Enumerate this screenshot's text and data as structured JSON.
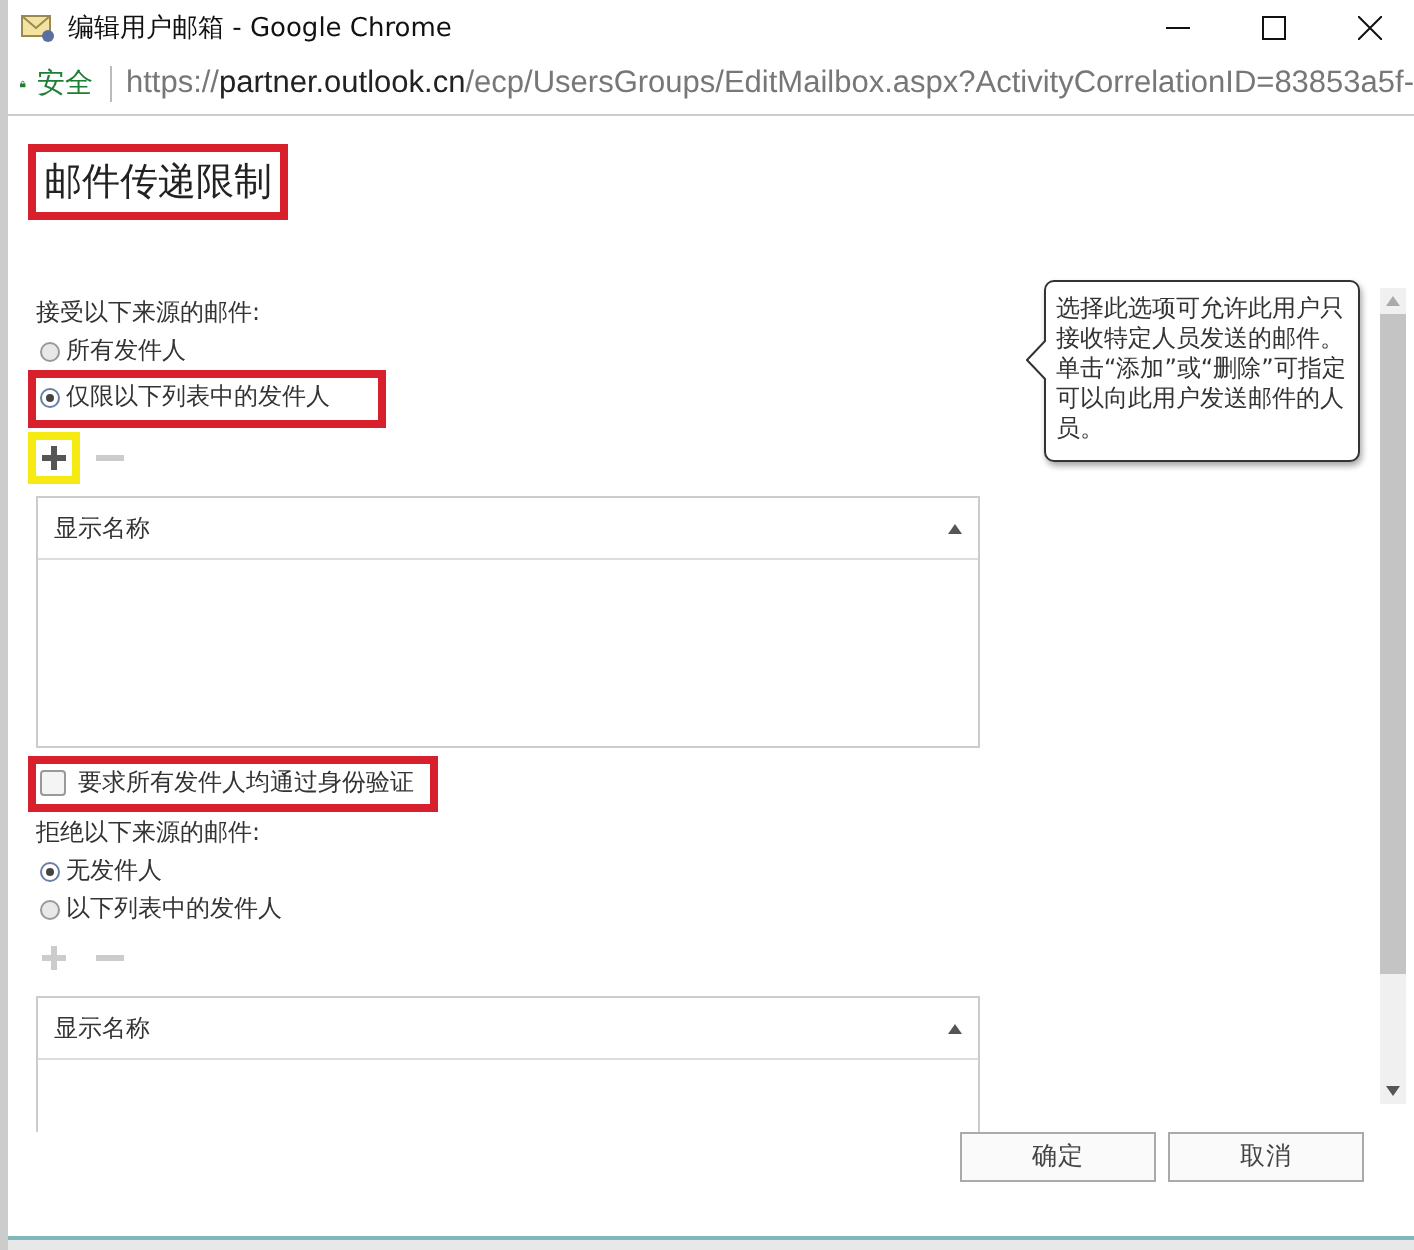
{
  "window": {
    "title": "编辑用户邮箱 - Google Chrome"
  },
  "address_bar": {
    "security_label": "安全",
    "scheme": "https://",
    "host": "partner.outlook.cn",
    "path": "/ecp/UsersGroups/EditMailbox.aspx?ActivityCorrelationID=83853a5f-"
  },
  "heading": {
    "text": "邮件传递限制",
    "color": "#d8202c"
  },
  "accept": {
    "label": "接受以下来源的邮件:",
    "options": [
      {
        "label": "所有发件人",
        "selected": false
      },
      {
        "label": "仅限以下列表中的发件人",
        "selected": true,
        "color": "#d8202c"
      }
    ],
    "add_button": {
      "disabled": false,
      "color": "#f5ea12"
    },
    "remove_button": {
      "disabled": true
    },
    "list": {
      "column": "显示名称"
    }
  },
  "require_auth": {
    "label": "要求所有发件人均通过身份验证",
    "checked": false,
    "color": "#d8202c"
  },
  "reject": {
    "label": "拒绝以下来源的邮件:",
    "options": [
      {
        "label": "无发件人",
        "selected": true
      },
      {
        "label": "以下列表中的发件人",
        "selected": false
      }
    ],
    "add_button": {
      "disabled": true
    },
    "remove_button": {
      "disabled": true
    },
    "list": {
      "column": "显示名称"
    }
  },
  "tooltip": {
    "text": "选择此选项可允许此用户只接收特定人员发送的邮件。单击“添加”或“删除”可指定可以向此用户发送邮件的人员。"
  },
  "buttons": [
    {
      "label": "确定"
    },
    {
      "label": "取消"
    }
  ]
}
